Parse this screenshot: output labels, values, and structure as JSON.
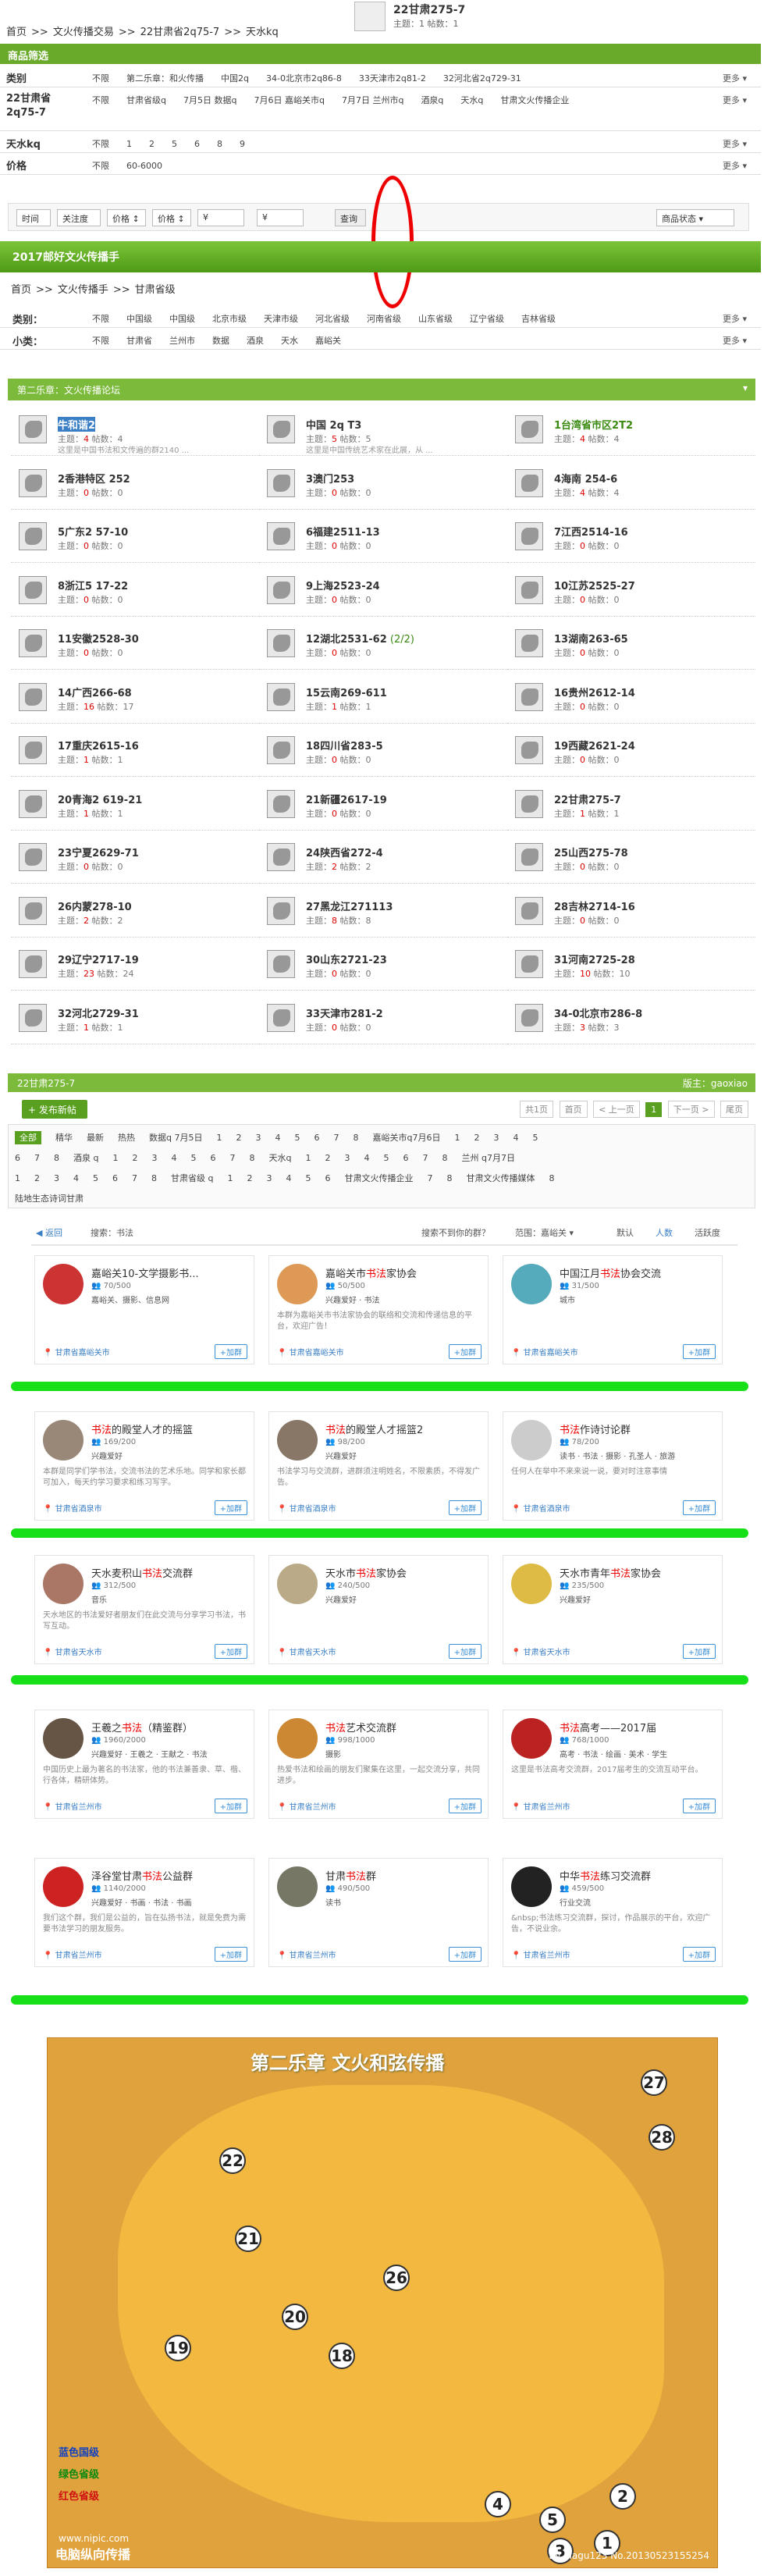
{
  "breadcrumb": [
    "首页",
    ">>",
    "文火传播交易",
    ">>",
    "22甘肃省2q75-7",
    ">>",
    "天水kq"
  ],
  "top": {
    "title": "22甘肃275-7",
    "stats": "主题：1 帖数：1"
  },
  "filter": {
    "head": "商品筛选",
    "more": "更多",
    "rows": [
      {
        "label": "类别",
        "options": [
          "不限",
          "第二乐章：和火传播",
          "中国2q",
          "34-0北京市2q86-8",
          "33天津市2q81-2",
          "32河北省2q729-31"
        ]
      },
      {
        "label": "22甘肃省2q75-7",
        "options": [
          "不限",
          "甘肃省级q",
          "7月5日 数据q",
          "7月6日 嘉峪关市q",
          "7月7日 兰州市q",
          "酒泉q",
          "天水q",
          "甘肃文火传播企业"
        ]
      },
      {
        "label": "天水kq",
        "options": [
          "不限",
          "1",
          "2",
          "5",
          "6",
          "8",
          "9"
        ]
      },
      {
        "label": "价格",
        "options": [
          "不限",
          "60-6000"
        ]
      }
    ]
  },
  "searchbar": {
    "time": "时间",
    "focus": "关注度",
    "price1": "价格",
    "price2": "价格",
    "from": "¥",
    "to": "¥",
    "query": "查询",
    "status": "商品状态"
  },
  "section2": {
    "title": "2017邮好文火传播手",
    "crumb": [
      "首页",
      ">>",
      "文火传播手",
      ">>",
      "甘肃省级"
    ]
  },
  "filter2": {
    "more": "更多",
    "rows": [
      {
        "label": "类别：",
        "options": [
          "不限",
          "中国级",
          "中国级",
          "北京市级",
          "天津市级",
          "河北省级",
          "河南省级",
          "山东省级",
          "辽宁省级",
          "吉林省级"
        ]
      },
      {
        "label": "小类：",
        "options": [
          "不限",
          "甘肃省",
          "兰州市",
          "数据",
          "酒泉",
          "天水",
          "嘉峪关"
        ]
      }
    ]
  },
  "forum": {
    "head": "第二乐章：文火传播论坛",
    "label_topic": "主题：",
    "label_posts": "帖数：",
    "cells": [
      {
        "name": "牛和谐2",
        "topics": "4",
        "posts": "4",
        "desc": "这里是中国书法和文传遍的群2140 ..."
      },
      {
        "name": "中国 2q T3",
        "topics": "5",
        "posts": "5",
        "desc": "这里是中国传统艺术家在此展，从 ..."
      },
      {
        "name": "1台湾省市区2T2",
        "topics": "4",
        "posts": "4",
        "desc": ""
      },
      {
        "name": "2香港特区 252",
        "topics": "0",
        "posts": "0"
      },
      {
        "name": "3澳门253",
        "topics": "0",
        "posts": "0"
      },
      {
        "name": "4海南 254-6",
        "topics": "4",
        "posts": "4"
      },
      {
        "name": "5广东2 57-10",
        "topics": "0",
        "posts": "0"
      },
      {
        "name": "6福建2511-13",
        "topics": "0",
        "posts": "0"
      },
      {
        "name": "7江西2514-16",
        "topics": "0",
        "posts": "0"
      },
      {
        "name": "8浙江5 17-22",
        "topics": "0",
        "posts": "0"
      },
      {
        "name": "9上海2523-24",
        "topics": "0",
        "posts": "0"
      },
      {
        "name": "10江苏2525-27",
        "topics": "0",
        "posts": "0"
      },
      {
        "name": "11安徽2528-30",
        "topics": "0",
        "posts": "0"
      },
      {
        "name": "12湖北2531-62",
        "extra": "(2/2)",
        "topics": "0",
        "posts": "0"
      },
      {
        "name": "13湖南263-65",
        "topics": "0",
        "posts": "0"
      },
      {
        "name": "14广西266-68",
        "topics": "16",
        "posts": "17"
      },
      {
        "name": "15云南269-611",
        "topics": "1",
        "posts": "1"
      },
      {
        "name": "16贵州2612-14",
        "topics": "0",
        "posts": "0"
      },
      {
        "name": "17重庆2615-16",
        "topics": "1",
        "posts": "1"
      },
      {
        "name": "18四川省283-5",
        "topics": "0",
        "posts": "0"
      },
      {
        "name": "19西藏2621-24",
        "topics": "0",
        "posts": "0"
      },
      {
        "name": "20青海2 619-21",
        "topics": "1",
        "posts": "1"
      },
      {
        "name": "21新疆2617-19",
        "topics": "0",
        "posts": "0"
      },
      {
        "name": "22甘肃275-7",
        "topics": "1",
        "posts": "1"
      },
      {
        "name": "23宁夏2629-71",
        "topics": "0",
        "posts": "0"
      },
      {
        "name": "24陕西省272-4",
        "topics": "2",
        "posts": "2"
      },
      {
        "name": "25山西275-78",
        "topics": "0",
        "posts": "0"
      },
      {
        "name": "26内蒙278-10",
        "topics": "2",
        "posts": "2"
      },
      {
        "name": "27黑龙江271113",
        "topics": "8",
        "posts": "8"
      },
      {
        "name": "28吉林2714-16",
        "topics": "0",
        "posts": "0"
      },
      {
        "name": "29辽宁2717-19",
        "topics": "23",
        "posts": "24"
      },
      {
        "name": "30山东2721-23",
        "topics": "0",
        "posts": "0"
      },
      {
        "name": "31河南2725-28",
        "topics": "10",
        "posts": "10"
      },
      {
        "name": "32河北2729-31",
        "topics": "1",
        "posts": "1"
      },
      {
        "name": "33天津市281-2",
        "topics": "0",
        "posts": "0"
      },
      {
        "name": "34-0北京市286-8",
        "topics": "3",
        "posts": "3"
      }
    ]
  },
  "subforum": {
    "head": "22甘肃275-7",
    "moderator": "版主：gaoxiao",
    "post_button": "+ 发布新帖",
    "pager": {
      "total": "共1页",
      "first": "首页",
      "prev": "< 上一页",
      "current": "1",
      "next": "下一页 >",
      "last": "尾页"
    },
    "tag_lines": [
      [
        "全部",
        "精华",
        "最新",
        "热热",
        "数据q 7月5日",
        "1",
        "2",
        "3",
        "4",
        "5",
        "6",
        "7",
        "8",
        "嘉峪关市q7月6日",
        "1",
        "2",
        "3",
        "4",
        "5"
      ],
      [
        "6",
        "7",
        "8",
        "酒泉 q",
        "1",
        "2",
        "3",
        "4",
        "5",
        "6",
        "7",
        "8",
        "天水q",
        "1",
        "2",
        "3",
        "4",
        "5",
        "6",
        "7",
        "8",
        "兰州 q7月7日"
      ],
      [
        "1",
        "2",
        "3",
        "4",
        "5",
        "6",
        "7",
        "8",
        "甘肃省级 q",
        "1",
        "2",
        "3",
        "4",
        "5",
        "6",
        "甘肃文火传播企业",
        "7",
        "8",
        "甘肃文火传播媒体",
        "8"
      ],
      [
        "陆地生态诗词甘肃"
      ]
    ]
  },
  "groups": {
    "back": "返回",
    "search_label": "搜索：书法",
    "not_found": "搜索不到你的群？",
    "range": "范围：嘉峪关",
    "sort_default": "默认",
    "sort_people": "人数",
    "sort_active": "活跃度",
    "join": "+加群",
    "cards": [
      {
        "name": "嘉峪关10-文学摄影书...",
        "count": "70/500",
        "tags": "嘉峪关、摄影、信息网",
        "desc": "",
        "loc": "甘肃省嘉峪关市",
        "color": "#c33"
      },
      {
        "name": "嘉峪关市书法家协会",
        "count": "50/500",
        "tags": "兴趣爱好 · 书法",
        "desc": "本群为嘉峪关市书法家协会的联络和交流和传递信息的平台，欢迎广告！",
        "loc": "甘肃省嘉峪关市",
        "color": "#d95"
      },
      {
        "name": "中国江月书法协会交流",
        "count": "31/500",
        "tags": "城市",
        "desc": "",
        "loc": "甘肃省嘉峪关市",
        "color": "#5ab"
      },
      {
        "name": "书法的殿堂人才的摇篮",
        "count": "169/200",
        "tags": "兴趣爱好",
        "desc": "本群是同学们学书法，交流书法的艺术乐地。同学和家长都可加入，每天约学习要求和练习写字。",
        "loc": "甘肃省酒泉市",
        "color": "#987"
      },
      {
        "name": "书法的殿堂人才摇篮2",
        "count": "98/200",
        "tags": "兴趣爱好",
        "desc": "书法学习与交流群，进群须注明姓名，不限素质，不得发广告。",
        "loc": "甘肃省酒泉市",
        "color": "#876"
      },
      {
        "name": "书法作诗讨论群",
        "count": "78/200",
        "tags": "读书 · 书法 · 摄影 · 孔圣人 · 旅游",
        "desc": "任何人在举中不来来说一说，要对时注意事情",
        "loc": "甘肃省酒泉市",
        "color": "#ccc"
      },
      {
        "name": "天水麦积山书法交流群",
        "count": "312/500",
        "tags": "音乐",
        "desc": "天水地区的书法爱好者朋友们在此交流与分享学习书法，书写互动。",
        "loc": "甘肃省天水市",
        "color": "#a76"
      },
      {
        "name": "天水市书法家协会",
        "count": "240/500",
        "tags": "兴趣爱好",
        "desc": "",
        "loc": "甘肃省天水市",
        "color": "#ba8"
      },
      {
        "name": "天水市青年书法家协会",
        "count": "235/500",
        "tags": "兴趣爱好",
        "desc": "",
        "loc": "甘肃省天水市",
        "color": "#db4"
      },
      {
        "name": "王羲之书法（精鉴群）",
        "count": "1960/2000",
        "tags": "兴趣爱好 · 王羲之 · 王献之 · 书法",
        "desc": "中国历史上最为著名的书法家，他的书法兼善隶、草、楷、行各体，精研体势。",
        "loc": "甘肃省兰州市",
        "color": "#654"
      },
      {
        "name": "书法艺术交流群",
        "count": "998/1000",
        "tags": "摄影",
        "desc": "热爱书法和绘画的朋友们聚集在这里，一起交流分享，共同进步。",
        "loc": "甘肃省兰州市",
        "color": "#c83"
      },
      {
        "name": "书法高考——2017届",
        "count": "768/1000",
        "tags": "高考 · 书法 · 绘画 · 美术 · 学生",
        "desc": "这里是书法高考交流群，2017届考生的交流互动平台。",
        "loc": "甘肃省兰州市",
        "color": "#b22"
      },
      {
        "name": "泽谷堂甘肃书法公益群",
        "count": "1140/2000",
        "tags": "兴趣爱好 · 书画 · 书法 · 书画",
        "desc": "我们这个群，我们是公益的，旨在弘扬书法，就是免费为需要书法学习的朋友服务。",
        "loc": "甘肃省兰州市",
        "color": "#c22"
      },
      {
        "name": "甘肃书法群",
        "count": "490/500",
        "tags": "读书",
        "desc": "",
        "loc": "甘肃省兰州市",
        "color": "#776"
      },
      {
        "name": "中华书法练习交流群",
        "count": "459/500",
        "tags": "行业交流",
        "desc": "&nbsp;书法练习交流群，探讨，作品展示的平台，欢迎广告，不说业余。",
        "loc": "甘肃省兰州市",
        "color": "#222"
      }
    ]
  },
  "poster": {
    "title": "第二乐章  文火和弦传播",
    "legend": [
      {
        "text": "蓝色国级",
        "color": "#1040c0"
      },
      {
        "text": "绿色省级",
        "color": "#0a8a10"
      },
      {
        "text": "红色省级",
        "color": "#d01010"
      }
    ],
    "foot": "电脑纵向传播",
    "foot2": "By xiagu123 No.20130523155254",
    "watermark": "www.nipic.com",
    "numbers": [
      "27",
      "28",
      "21",
      "20",
      "26",
      "19",
      "18",
      "22",
      "4",
      "5",
      "2",
      "3",
      "1"
    ]
  }
}
